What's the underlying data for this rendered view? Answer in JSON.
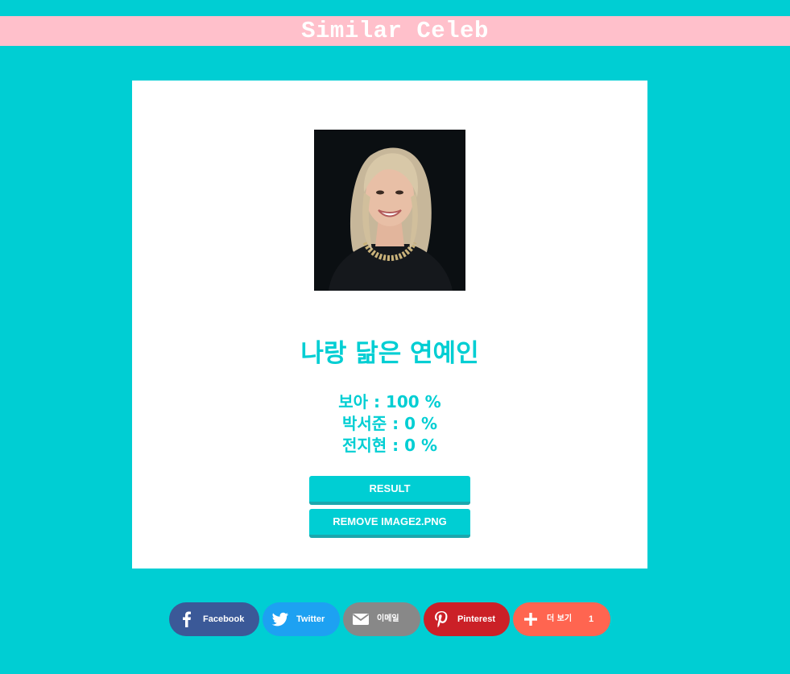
{
  "header": {
    "title": "Similar Celeb"
  },
  "card": {
    "photo_alt": "Uploaded photo",
    "heading": "나랑 닮은 연예인",
    "results": [
      "보아 : 100 %",
      "박서준 : 0 %",
      "전지현 : 0 %"
    ],
    "result_button": "RESULT",
    "remove_button": "REMOVE IMAGE2.PNG"
  },
  "share": {
    "facebook": "Facebook",
    "twitter": "Twitter",
    "email": "이메일",
    "pinterest": "Pinterest",
    "more": "더 보기",
    "more_count": "1"
  },
  "colors": {
    "background": "#00ced3",
    "title_bar": "#ffc0cb",
    "accent": "#00ced3",
    "facebook": "#3b5998",
    "twitter": "#1da1f2",
    "email": "#888888",
    "pinterest": "#cb2027",
    "more": "#ff6550"
  },
  "icons": {
    "facebook": "facebook-icon",
    "twitter": "twitter-icon",
    "email": "envelope-icon",
    "pinterest": "pinterest-icon",
    "more": "plus-icon"
  }
}
